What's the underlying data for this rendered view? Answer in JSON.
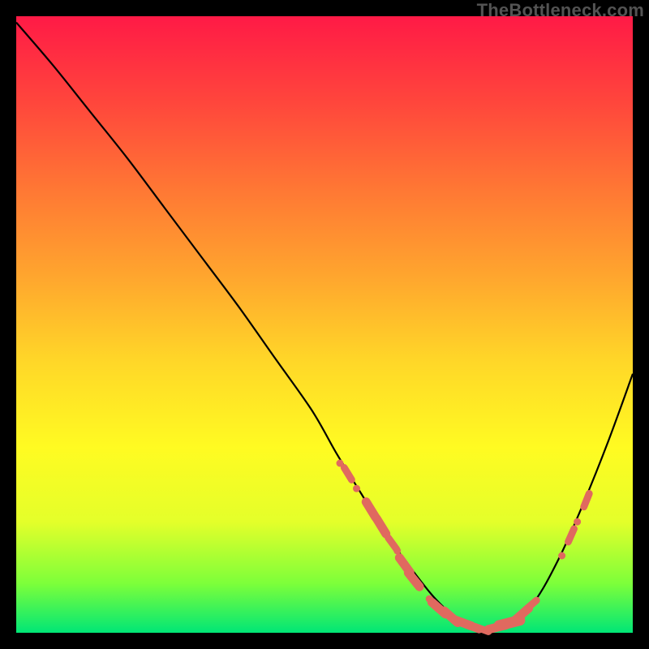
{
  "branding": {
    "watermark": "TheBottleneck.com"
  },
  "chart_data": {
    "type": "line",
    "title": "",
    "xlabel": "",
    "ylabel": "",
    "x_range": [
      0,
      100
    ],
    "y_range": [
      0,
      100
    ],
    "grid": false,
    "legend": false,
    "curve": {
      "name": "bottleneck-curve",
      "x": [
        0,
        6,
        12,
        18,
        24,
        30,
        36,
        42,
        48,
        52,
        56,
        60,
        64,
        68,
        72,
        76,
        80,
        84,
        88,
        92,
        96,
        100
      ],
      "y": [
        99,
        92,
        84.5,
        77,
        69,
        61,
        53,
        44.5,
        36,
        29,
        22.5,
        16,
        10.5,
        5.5,
        2,
        0.5,
        1.5,
        5,
        12,
        21,
        31,
        42
      ]
    },
    "markers": [
      {
        "x": 52.5,
        "y": 27.5,
        "size": 6
      },
      {
        "x": 53.8,
        "y": 25.8,
        "size": 8
      },
      {
        "x": 55.2,
        "y": 23.4,
        "size": 6
      },
      {
        "x": 57.5,
        "y": 20.0,
        "size": 10
      },
      {
        "x": 59.2,
        "y": 17.3,
        "size": 10
      },
      {
        "x": 61.0,
        "y": 14.5,
        "size": 8
      },
      {
        "x": 61.8,
        "y": 13.3,
        "size": 6
      },
      {
        "x": 63.0,
        "y": 11.0,
        "size": 10
      },
      {
        "x": 64.5,
        "y": 8.6,
        "size": 10
      },
      {
        "x": 67.0,
        "y": 5.5,
        "size": 6
      },
      {
        "x": 68.5,
        "y": 4.0,
        "size": 10
      },
      {
        "x": 70.5,
        "y": 2.6,
        "size": 10
      },
      {
        "x": 72.5,
        "y": 1.6,
        "size": 10
      },
      {
        "x": 74.0,
        "y": 0.9,
        "size": 8
      },
      {
        "x": 75.5,
        "y": 0.6,
        "size": 8
      },
      {
        "x": 78.0,
        "y": 0.9,
        "size": 10
      },
      {
        "x": 80.0,
        "y": 1.6,
        "size": 12
      },
      {
        "x": 82.0,
        "y": 3.0,
        "size": 10
      },
      {
        "x": 83.5,
        "y": 4.5,
        "size": 8
      },
      {
        "x": 88.5,
        "y": 12.5,
        "size": 6
      },
      {
        "x": 90.0,
        "y": 15.8,
        "size": 8
      },
      {
        "x": 91.0,
        "y": 18.0,
        "size": 6
      },
      {
        "x": 92.5,
        "y": 21.5,
        "size": 8
      }
    ]
  }
}
